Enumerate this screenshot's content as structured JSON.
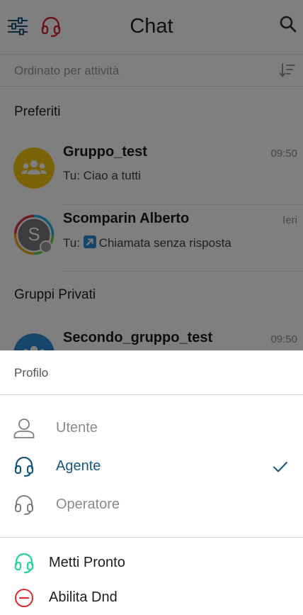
{
  "header": {
    "title": "Chat",
    "filter_icon": "sliders-icon",
    "status_icon": "headset-icon",
    "search_icon": "search-icon"
  },
  "sort": {
    "label": "Ordinato per attività",
    "icon": "sort-icon"
  },
  "sections": {
    "favorites": "Preferiti",
    "private_groups": "Gruppi Privati"
  },
  "chats": [
    {
      "name": "Gruppo_test",
      "time": "09:50",
      "message": "Tu: Ciao a tutti",
      "avatar": "group-icon"
    },
    {
      "name": "Scomparin Alberto",
      "time": "Ieri",
      "message": "Chiamata senza risposta",
      "prefix": "Tu:",
      "avatar_initial": "S"
    },
    {
      "name": "Secondo_gruppo_test",
      "time": "09:50",
      "avatar": "group-icon"
    }
  ],
  "sheet": {
    "title": "Profilo",
    "profiles": [
      {
        "label": "Utente",
        "icon": "user-icon",
        "selected": false
      },
      {
        "label": "Agente",
        "icon": "headset-icon",
        "selected": true
      },
      {
        "label": "Operatore",
        "icon": "headset-icon",
        "selected": false
      }
    ],
    "actions": [
      {
        "label": "Metti Pronto",
        "icon": "headset-icon"
      },
      {
        "label": "Abilita Dnd",
        "icon": "do-not-disturb-icon"
      }
    ]
  },
  "colors": {
    "accent": "#16567a",
    "status_red": "#d92b2b",
    "ready_green": "#2fd3a0",
    "group_avatar": "#f2c40f",
    "private_group_avatar": "#2d8fd6"
  }
}
